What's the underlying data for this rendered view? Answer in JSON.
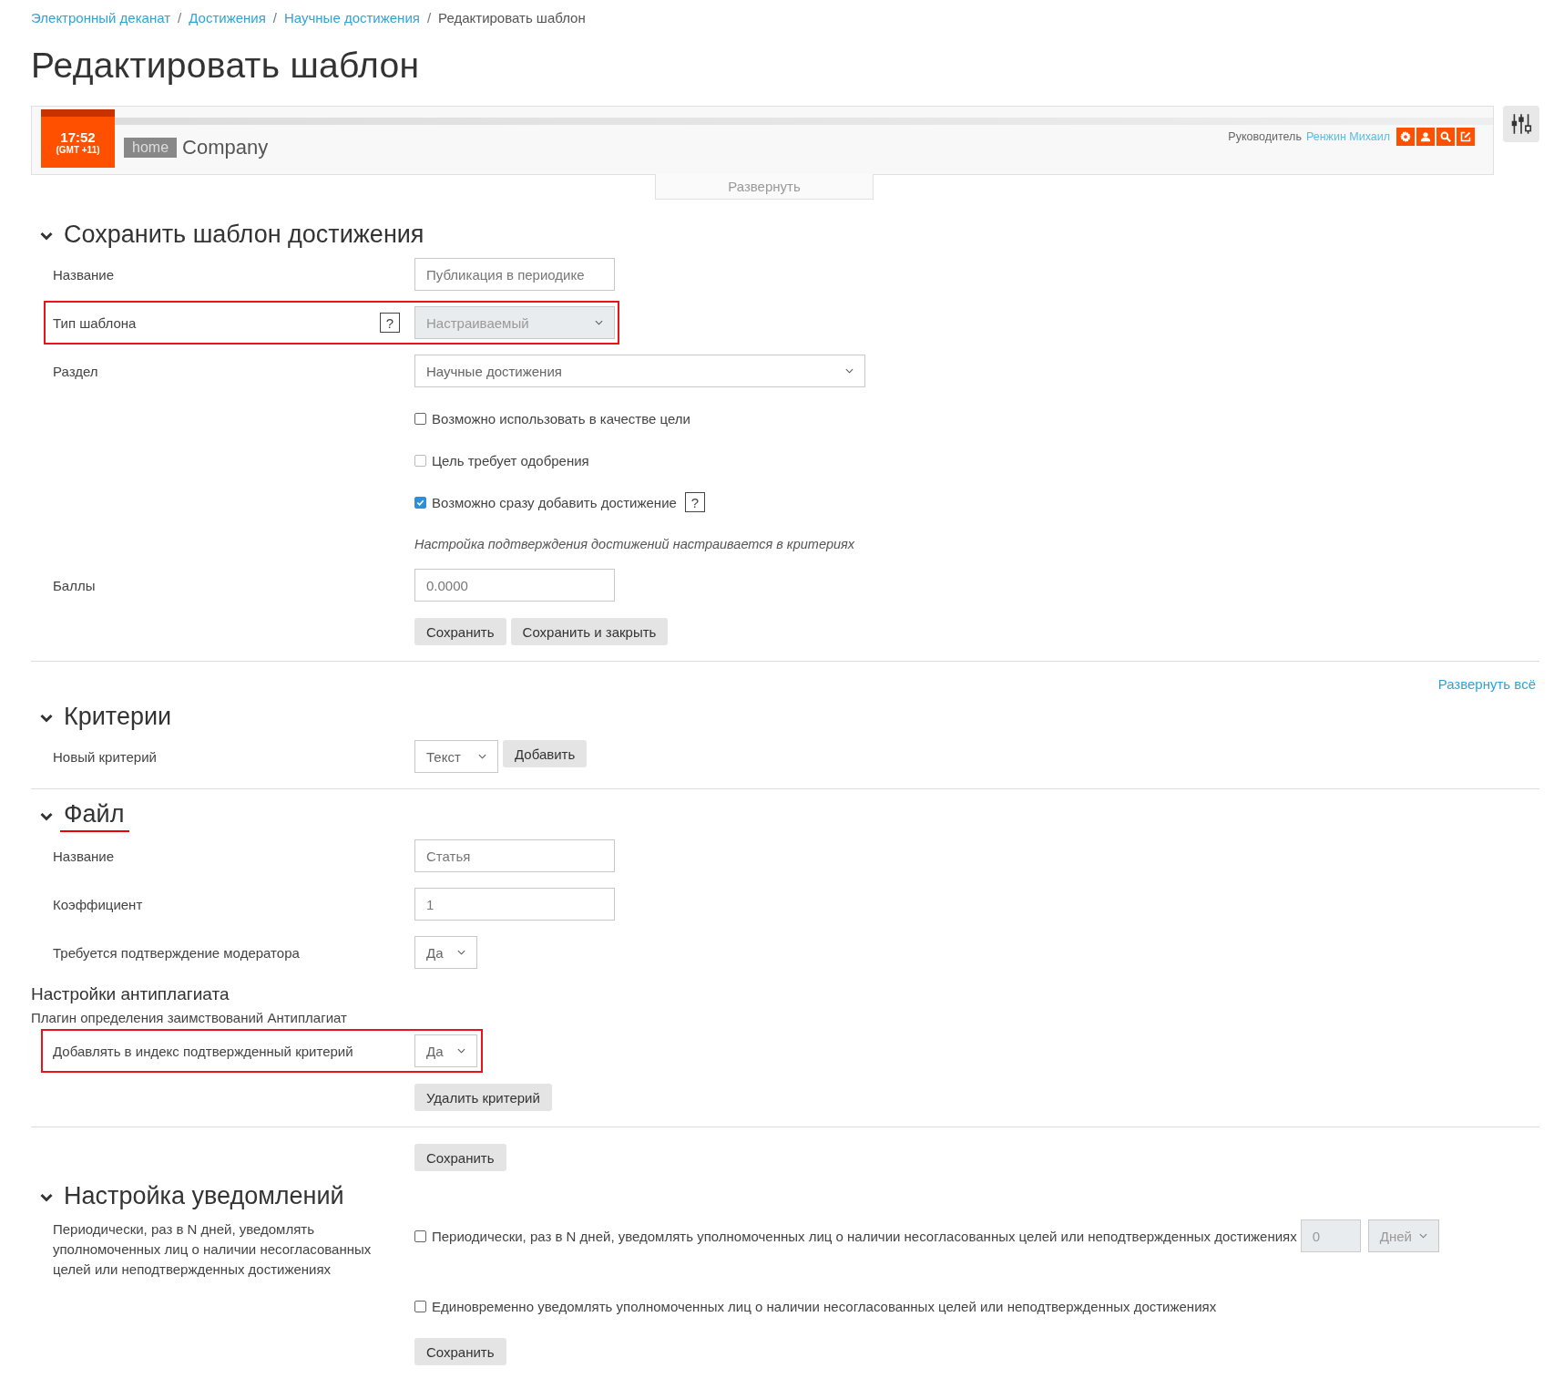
{
  "breadcrumb": {
    "separator": "/",
    "items": [
      {
        "label": "Электронный деканат",
        "link": true
      },
      {
        "label": "Достижения",
        "link": true
      },
      {
        "label": "Научные достижения",
        "link": true
      },
      {
        "label": "Редактировать шаблон",
        "link": false
      }
    ]
  },
  "page_title": "Редактировать шаблон",
  "header": {
    "time": "17:52",
    "timezone": "(GMT +11)",
    "home_badge": "home",
    "company": "Company",
    "role": "Руководитель",
    "user": "Ренжин Михаил",
    "expand_tab": "Развернуть"
  },
  "sections": [
    {
      "title": "Сохранить шаблон достижения",
      "expanded": true,
      "underlined": false,
      "rows": [
        {
          "kind": "input",
          "label": "Название",
          "value": "Публикация в периодике",
          "highlighted": false
        },
        {
          "kind": "select",
          "label": "Тип шаблона",
          "value": "Настраиваемый",
          "help": "?",
          "disabled": true,
          "highlighted": true
        },
        {
          "kind": "longselect",
          "label": "Раздел",
          "value": "Научные достижения",
          "disabled": false,
          "highlighted": false
        },
        {
          "kind": "checkbox",
          "text": "Возможно использовать в качестве цели",
          "checked": false,
          "disabled": false
        },
        {
          "kind": "checkbox",
          "text": "Цель требует одобрения",
          "checked": false,
          "disabled": true
        },
        {
          "kind": "checkbox",
          "text": "Возможно сразу добавить достижение",
          "checked": true,
          "disabled": false,
          "help": "?"
        },
        {
          "kind": "note",
          "text": "Настройка подтверждения достижений настраивается в критериях"
        },
        {
          "kind": "input",
          "label": "Баллы",
          "value": "0.0000",
          "highlighted": false
        },
        {
          "kind": "buttons",
          "buttons": [
            "Сохранить",
            "Сохранить и закрыть"
          ]
        },
        {
          "kind": "divider"
        }
      ]
    },
    {
      "title": "Критерии",
      "expanded": true,
      "underlined": false,
      "expand_all": "Развернуть всё",
      "rows": [
        {
          "kind": "add",
          "label": "Новый критерий",
          "value": "Текст",
          "button": "Добавить"
        },
        {
          "kind": "divider"
        }
      ]
    },
    {
      "title": "Файл",
      "expanded": true,
      "underlined": true,
      "rows": [
        {
          "kind": "input",
          "label": "Название",
          "value": "Статья",
          "highlighted": false
        },
        {
          "kind": "input",
          "label": "Коэффициент",
          "value": "1",
          "highlighted": false
        },
        {
          "kind": "shortselect",
          "label": "Требуется подтверждение модератора",
          "value": "Да",
          "disabled": false,
          "highlighted": false
        },
        {
          "kind": "subheading",
          "text": "Настройки антиплагиата"
        },
        {
          "kind": "caption",
          "text": "Плагин определения заимствований Антиплагиат"
        },
        {
          "kind": "shortselect",
          "label": "Добавлять в индекс подтвержденный критерий",
          "value": "Да",
          "disabled": false,
          "highlighted": true
        },
        {
          "kind": "buttons",
          "buttons": [
            "Удалить критерий"
          ]
        },
        {
          "kind": "divider"
        },
        {
          "kind": "buttons",
          "buttons": [
            "Сохранить"
          ]
        }
      ]
    },
    {
      "title": "Настройка уведомлений",
      "expanded": true,
      "underlined": false,
      "rows": [
        {
          "kind": "periodic",
          "label": "Периодически, раз в N дней, уведомлять уполномоченных лиц о наличии несогласованных целей или неподтвержденных достижениях",
          "text": "Периодически, раз в N дней, уведомлять уполномоченных лиц о наличии несогласованных целей или неподтвержденных достижениях",
          "checked": false,
          "number": "0",
          "unit": "Дней",
          "disabled": true
        },
        {
          "kind": "checkbox",
          "text": "Единовременно уведомлять уполномоченных лиц о наличии несогласованных целей или неподтвержденных достижениях",
          "checked": false,
          "disabled": false
        },
        {
          "kind": "buttons",
          "buttons": [
            "Сохранить"
          ]
        }
      ]
    }
  ]
}
